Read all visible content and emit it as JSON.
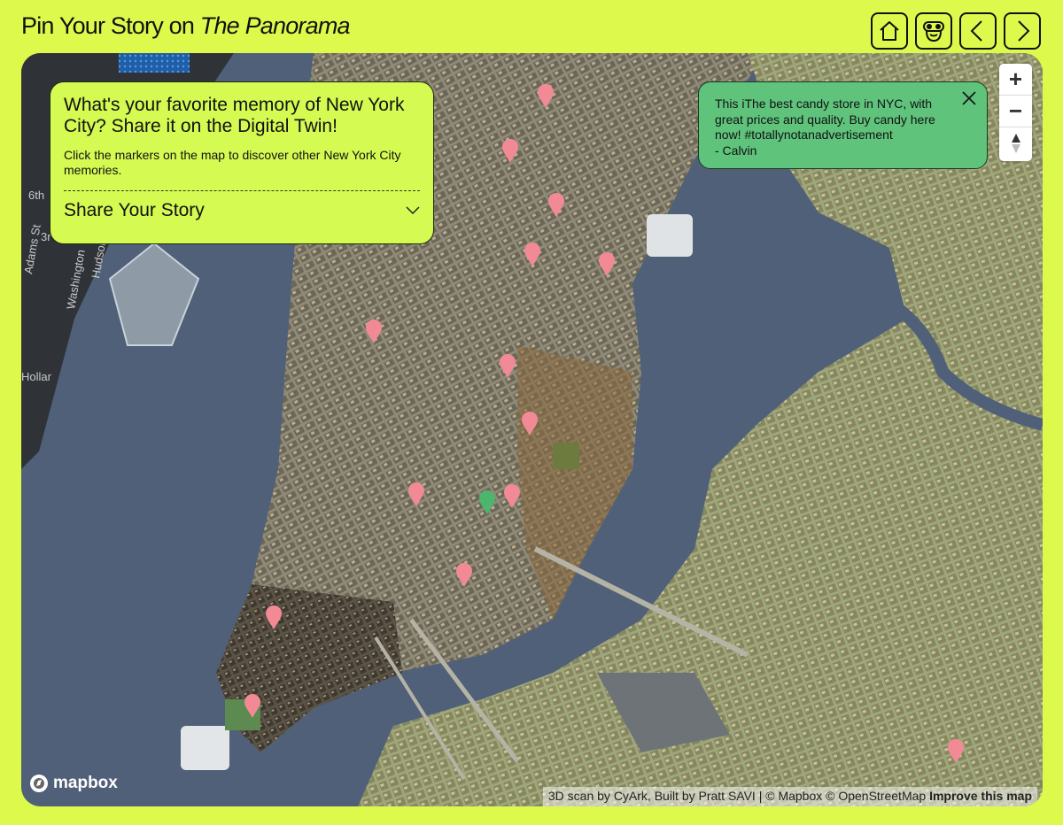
{
  "header": {
    "title_prefix": "Pin Your Story on ",
    "title_emphasis": "The Panorama"
  },
  "nav": [
    {
      "icon": "home-icon"
    },
    {
      "icon": "viewer-icon"
    },
    {
      "icon": "chevron-left-icon"
    },
    {
      "icon": "chevron-right-icon"
    }
  ],
  "info_panel": {
    "title": "What's your favorite memory of New York City? Share it on the Digital Twin!",
    "subtitle": "Click the markers on the map to discover other New York City memories.",
    "share_label": "Share Your Story"
  },
  "popup": {
    "text": "This iThe best candy store in NYC, with great prices and quality. Buy candy here now! #totallynotanadvertisement",
    "author": "- Calvin"
  },
  "zoom": {
    "in": "+",
    "out": "−"
  },
  "map_labels": {
    "street_1": "Adams St",
    "street_2": "Washington",
    "street_3": "Hudson",
    "street_4": "6th",
    "street_5": "3r",
    "street_6": "Hollar"
  },
  "attribution": {
    "logo": "mapbox",
    "credit": "3D scan by CyArk, Built by Pratt SAVI | © Mapbox © OpenStreetMap",
    "improve": "Improve this map"
  },
  "colors": {
    "accent": "#ddfa4c",
    "panel": "#d5fa52",
    "popup": "#5fc37c",
    "marker": "#f28a96",
    "marker_active": "#4cb66e"
  }
}
